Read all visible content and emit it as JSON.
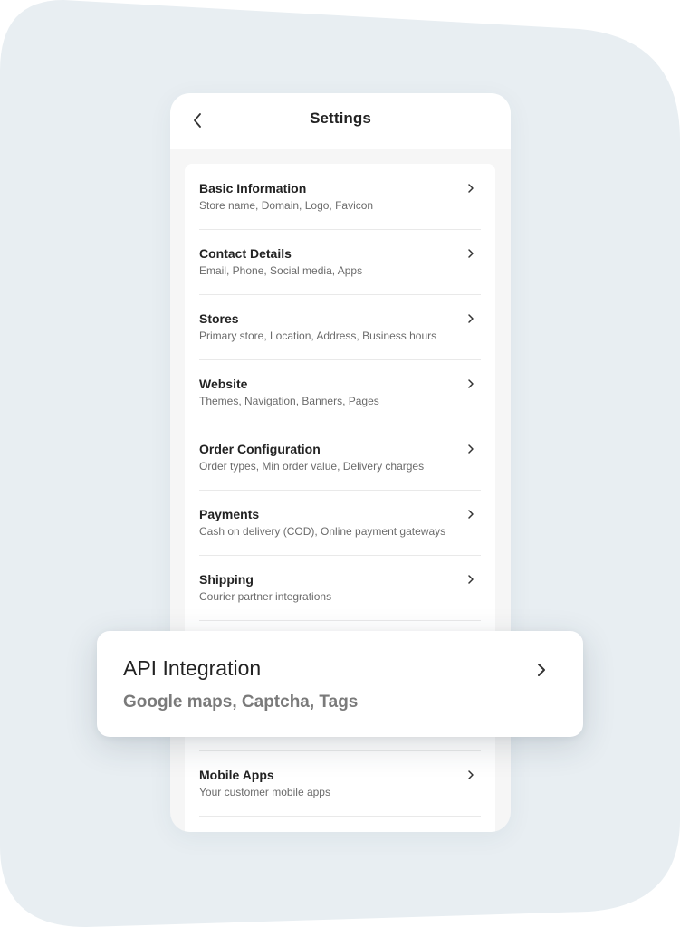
{
  "header": {
    "title": "Settings",
    "back_icon": "chevron-left-icon"
  },
  "settings": {
    "items": [
      {
        "title": "Basic Information",
        "subtitle": "Store name, Domain, Logo, Favicon"
      },
      {
        "title": "Contact Details",
        "subtitle": "Email, Phone, Social media, Apps"
      },
      {
        "title": "Stores",
        "subtitle": "Primary store, Location, Address, Business hours"
      },
      {
        "title": "Website",
        "subtitle": "Themes, Navigation, Banners, Pages"
      },
      {
        "title": "Order Configuration",
        "subtitle": "Order types, Min order value, Delivery charges"
      },
      {
        "title": "Payments",
        "subtitle": "Cash on delivery (COD), Online payment gateways"
      },
      {
        "title": "Shipping",
        "subtitle": "Courier partner integrations"
      },
      {
        "title": "Mobile Apps",
        "subtitle": "Your customer mobile apps"
      }
    ],
    "item_icon": "chevron-right-icon"
  },
  "highlight": {
    "title": "API Integration",
    "subtitle": "Google maps, Captcha, Tags",
    "icon": "chevron-right-icon"
  },
  "colors": {
    "background_blob": "#e8eef2",
    "phone_background": "#f6f6f6",
    "card_background": "#ffffff",
    "title_text": "#222222",
    "subtitle_text": "#6b6b6b"
  }
}
